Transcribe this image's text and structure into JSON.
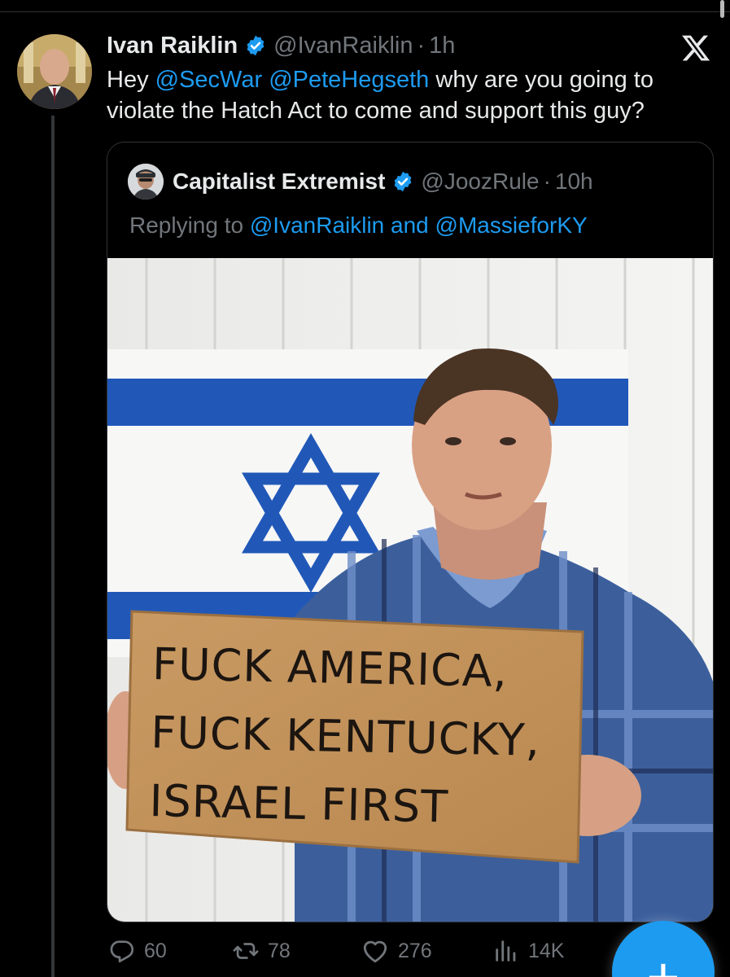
{
  "tweet": {
    "author_name": "Ivan Raiklin",
    "handle": "@IvanRaiklin",
    "separator": "·",
    "time": "1h",
    "text": {
      "prefix": "Hey ",
      "mention1": "@SecWar",
      "space": " ",
      "mention2": "@PeteHegseth",
      "suffix": " why are you going to violate the Hatch Act to come and support this guy?"
    }
  },
  "quote": {
    "author_name": "Capitalist Extremist",
    "handle": "@JoozRule",
    "separator": "·",
    "time": "10h",
    "replying_prefix": "Replying to ",
    "replying_mention1": "@IvanRaiklin",
    "replying_and": " and ",
    "replying_mention2": "@MassieforKY",
    "image": {
      "sign_line1": "FUCK AMERICA,",
      "sign_line2": "FUCK KENTUCKY,",
      "sign_line3": "ISRAEL FIRST"
    }
  },
  "actions": {
    "replies": "60",
    "reposts": "78",
    "likes": "276",
    "views": "14K"
  },
  "fab": {
    "icon_label": "+"
  },
  "icons": {
    "verified": "verified-badge-icon",
    "x_logo": "x-logo-icon",
    "reply": "reply-icon",
    "repost": "repost-icon",
    "like": "heart-icon",
    "views": "views-icon"
  },
  "colors": {
    "background": "#000000",
    "text": "#e7e9ea",
    "muted": "#71767b",
    "accent": "#1d9bf0",
    "border": "#2f3336"
  }
}
